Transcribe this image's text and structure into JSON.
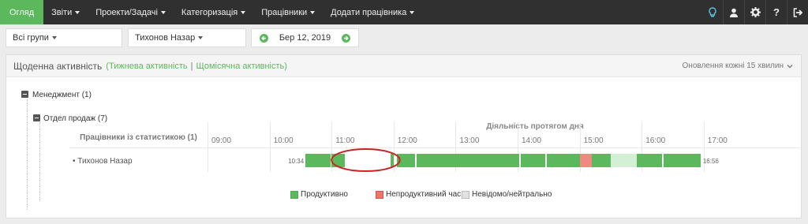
{
  "nav": {
    "items": [
      {
        "label": "Огляд",
        "active": true,
        "caret": false
      },
      {
        "label": "Звіти",
        "active": false,
        "caret": true
      },
      {
        "label": "Проекти/Задачі",
        "active": false,
        "caret": true
      },
      {
        "label": "Категоризація",
        "active": false,
        "caret": true
      },
      {
        "label": "Працівники",
        "active": false,
        "caret": true
      },
      {
        "label": "Додати працівника",
        "active": false,
        "caret": true
      }
    ],
    "icons": [
      "lightbulb-icon",
      "user-icon",
      "gear-icon",
      "help-icon",
      "logout-icon"
    ]
  },
  "filters": {
    "group": "Всі групи",
    "employee": "Тихонов Назар",
    "date": "Бер 12, 2019"
  },
  "panel": {
    "title": "Щоденна активність",
    "weekly": "Тижнева активність",
    "separator": "|",
    "monthly": "Щомісячна активність",
    "refresh": "Оновлення кожні 15 хвилин"
  },
  "tree": {
    "management": "Менеджмент (1)",
    "sales": "Отдел продаж (7)"
  },
  "timeline": {
    "section_title": "Діяльність протягом дня",
    "column_label": "Працівники із статистикою (1)",
    "hours": [
      "09:00",
      "10:00",
      "11:00",
      "12:00",
      "13:00",
      "14:00",
      "15:00",
      "16:00",
      "17:00"
    ],
    "employee": "• Тихонов Назар",
    "start_time": "10:34",
    "end_time": "16:56",
    "segments": [
      {
        "start": 10.58,
        "end": 10.98,
        "kind": "productive"
      },
      {
        "start": 11.0,
        "end": 11.22,
        "kind": "productive"
      },
      {
        "start": 11.22,
        "end": 11.95,
        "kind": "neutral"
      },
      {
        "start": 11.95,
        "end": 12.0,
        "kind": "productive"
      },
      {
        "start": 12.05,
        "end": 12.35,
        "kind": "productive"
      },
      {
        "start": 12.37,
        "end": 14.03,
        "kind": "productive"
      },
      {
        "start": 14.05,
        "end": 14.45,
        "kind": "productive"
      },
      {
        "start": 14.47,
        "end": 15.0,
        "kind": "productive"
      },
      {
        "start": 15.0,
        "end": 15.2,
        "kind": "unproductive"
      },
      {
        "start": 15.2,
        "end": 15.5,
        "kind": "productive"
      },
      {
        "start": 15.5,
        "end": 15.92,
        "kind": "light"
      },
      {
        "start": 15.92,
        "end": 16.0,
        "kind": "productive"
      },
      {
        "start": 16.0,
        "end": 16.33,
        "kind": "productive"
      },
      {
        "start": 16.35,
        "end": 16.95,
        "kind": "productive"
      }
    ],
    "highlight": {
      "start": 11.0,
      "end": 12.1
    }
  },
  "legend": [
    {
      "label": "Продуктивно",
      "color": "#5cb85c"
    },
    {
      "label": "Непродуктивний час",
      "color": "#e8786c"
    },
    {
      "label": "Невідомо/нейтрально",
      "color": "#e2e2e2"
    }
  ],
  "colors": {
    "accent": "#5cb85c",
    "productive": "#5cb85c",
    "unproductive": "#f08a80",
    "neutral": "#ffffff",
    "light": "#d4f0d4",
    "highlight": "#cc2222"
  }
}
